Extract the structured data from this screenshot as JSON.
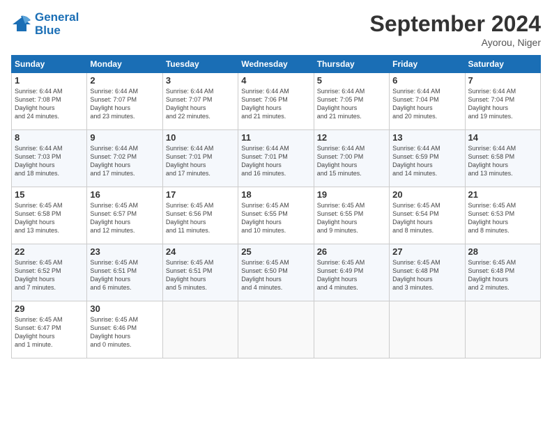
{
  "header": {
    "logo_line1": "General",
    "logo_line2": "Blue",
    "month": "September 2024",
    "location": "Ayorou, Niger"
  },
  "days_of_week": [
    "Sunday",
    "Monday",
    "Tuesday",
    "Wednesday",
    "Thursday",
    "Friday",
    "Saturday"
  ],
  "weeks": [
    [
      {
        "day": "1",
        "sunrise": "6:44 AM",
        "sunset": "7:08 PM",
        "daylight": "12 hours and 24 minutes."
      },
      {
        "day": "2",
        "sunrise": "6:44 AM",
        "sunset": "7:07 PM",
        "daylight": "12 hours and 23 minutes."
      },
      {
        "day": "3",
        "sunrise": "6:44 AM",
        "sunset": "7:07 PM",
        "daylight": "12 hours and 22 minutes."
      },
      {
        "day": "4",
        "sunrise": "6:44 AM",
        "sunset": "7:06 PM",
        "daylight": "12 hours and 21 minutes."
      },
      {
        "day": "5",
        "sunrise": "6:44 AM",
        "sunset": "7:05 PM",
        "daylight": "12 hours and 21 minutes."
      },
      {
        "day": "6",
        "sunrise": "6:44 AM",
        "sunset": "7:04 PM",
        "daylight": "12 hours and 20 minutes."
      },
      {
        "day": "7",
        "sunrise": "6:44 AM",
        "sunset": "7:04 PM",
        "daylight": "12 hours and 19 minutes."
      }
    ],
    [
      {
        "day": "8",
        "sunrise": "6:44 AM",
        "sunset": "7:03 PM",
        "daylight": "12 hours and 18 minutes."
      },
      {
        "day": "9",
        "sunrise": "6:44 AM",
        "sunset": "7:02 PM",
        "daylight": "12 hours and 17 minutes."
      },
      {
        "day": "10",
        "sunrise": "6:44 AM",
        "sunset": "7:01 PM",
        "daylight": "12 hours and 17 minutes."
      },
      {
        "day": "11",
        "sunrise": "6:44 AM",
        "sunset": "7:01 PM",
        "daylight": "12 hours and 16 minutes."
      },
      {
        "day": "12",
        "sunrise": "6:44 AM",
        "sunset": "7:00 PM",
        "daylight": "12 hours and 15 minutes."
      },
      {
        "day": "13",
        "sunrise": "6:44 AM",
        "sunset": "6:59 PM",
        "daylight": "12 hours and 14 minutes."
      },
      {
        "day": "14",
        "sunrise": "6:44 AM",
        "sunset": "6:58 PM",
        "daylight": "12 hours and 13 minutes."
      }
    ],
    [
      {
        "day": "15",
        "sunrise": "6:45 AM",
        "sunset": "6:58 PM",
        "daylight": "12 hours and 13 minutes."
      },
      {
        "day": "16",
        "sunrise": "6:45 AM",
        "sunset": "6:57 PM",
        "daylight": "12 hours and 12 minutes."
      },
      {
        "day": "17",
        "sunrise": "6:45 AM",
        "sunset": "6:56 PM",
        "daylight": "12 hours and 11 minutes."
      },
      {
        "day": "18",
        "sunrise": "6:45 AM",
        "sunset": "6:55 PM",
        "daylight": "12 hours and 10 minutes."
      },
      {
        "day": "19",
        "sunrise": "6:45 AM",
        "sunset": "6:55 PM",
        "daylight": "12 hours and 9 minutes."
      },
      {
        "day": "20",
        "sunrise": "6:45 AM",
        "sunset": "6:54 PM",
        "daylight": "12 hours and 8 minutes."
      },
      {
        "day": "21",
        "sunrise": "6:45 AM",
        "sunset": "6:53 PM",
        "daylight": "12 hours and 8 minutes."
      }
    ],
    [
      {
        "day": "22",
        "sunrise": "6:45 AM",
        "sunset": "6:52 PM",
        "daylight": "12 hours and 7 minutes."
      },
      {
        "day": "23",
        "sunrise": "6:45 AM",
        "sunset": "6:51 PM",
        "daylight": "12 hours and 6 minutes."
      },
      {
        "day": "24",
        "sunrise": "6:45 AM",
        "sunset": "6:51 PM",
        "daylight": "12 hours and 5 minutes."
      },
      {
        "day": "25",
        "sunrise": "6:45 AM",
        "sunset": "6:50 PM",
        "daylight": "12 hours and 4 minutes."
      },
      {
        "day": "26",
        "sunrise": "6:45 AM",
        "sunset": "6:49 PM",
        "daylight": "12 hours and 4 minutes."
      },
      {
        "day": "27",
        "sunrise": "6:45 AM",
        "sunset": "6:48 PM",
        "daylight": "12 hours and 3 minutes."
      },
      {
        "day": "28",
        "sunrise": "6:45 AM",
        "sunset": "6:48 PM",
        "daylight": "12 hours and 2 minutes."
      }
    ],
    [
      {
        "day": "29",
        "sunrise": "6:45 AM",
        "sunset": "6:47 PM",
        "daylight": "12 hours and 1 minute."
      },
      {
        "day": "30",
        "sunrise": "6:45 AM",
        "sunset": "6:46 PM",
        "daylight": "12 hours and 0 minutes."
      },
      null,
      null,
      null,
      null,
      null
    ]
  ]
}
